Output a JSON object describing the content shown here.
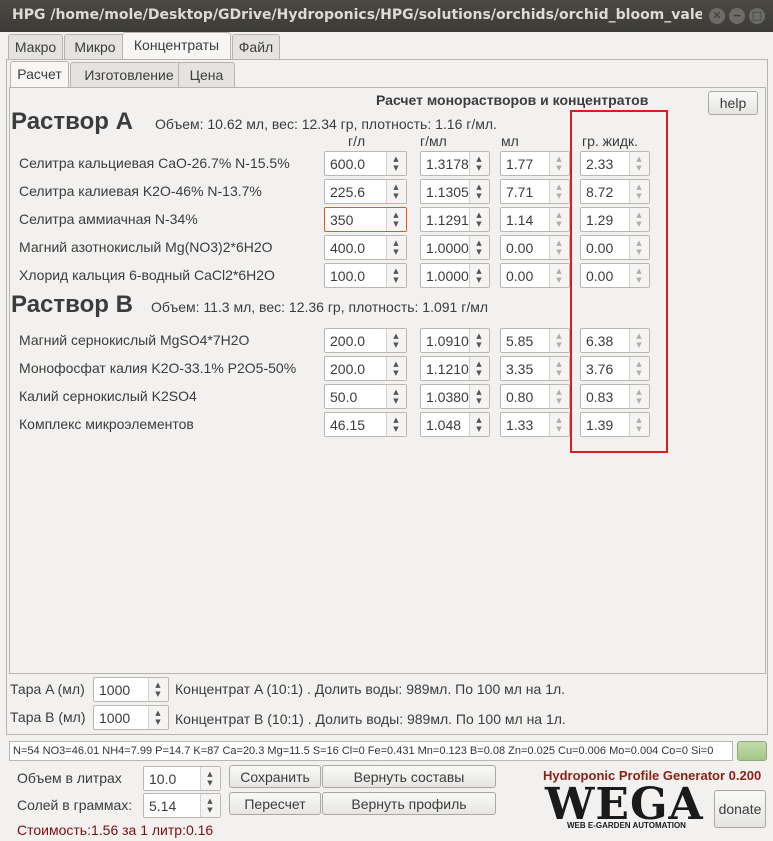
{
  "window": {
    "title": "HPG /home/mole/Desktop/GDrive/Hydroponics/HPG/solutions/orchids/orchid_bloom_valery.hp..."
  },
  "top_tabs": [
    "Макро",
    "Микро",
    "Концентраты",
    "Файл"
  ],
  "sub_tabs": [
    "Расчет",
    "Изготовление",
    "Цена"
  ],
  "main": {
    "section_title": "Расчет монорастворов и концентратов",
    "help_label": "help",
    "col_headers": [
      "г/л",
      "г/мл",
      "мл",
      "гр. жидк."
    ],
    "solution_a": {
      "title": "Раствор A",
      "info": "Объем: 10.62 мл, вес: 12.34 гр, плотность: 1.16 г/мл.",
      "rows": [
        {
          "name": "Селитра кальциевая CaO-26.7% N-15.5%",
          "gl": "600.0",
          "gml": "1.3178",
          "ml": "1.77",
          "gr": "2.33"
        },
        {
          "name": "Селитра калиевая K2O-46% N-13.7%",
          "gl": "225.6",
          "gml": "1.1305",
          "ml": "7.71",
          "gr": "8.72"
        },
        {
          "name": "Селитра аммиачная N-34%",
          "gl": "350",
          "gml": "1.1291",
          "ml": "1.14",
          "gr": "1.29"
        },
        {
          "name": "Магний азотнокислый Mg(NO3)2*6H2O",
          "gl": "400.0",
          "gml": "1.0000",
          "ml": "0.00",
          "gr": "0.00"
        },
        {
          "name": "Хлорид кальция 6-водный CaCl2*6H2O",
          "gl": "100.0",
          "gml": "1.0000",
          "ml": "0.00",
          "gr": "0.00"
        }
      ]
    },
    "solution_b": {
      "title": "Раствор B",
      "info": "Объем: 11.3 мл, вес: 12.36 гр, плотность: 1.091 г/мл",
      "rows": [
        {
          "name": "Магний сернокислый MgSO4*7H2O",
          "gl": "200.0",
          "gml": "1.0910",
          "ml": "5.85",
          "gr": "6.38"
        },
        {
          "name": "Монофосфат калия K2O-33.1% P2O5-50%",
          "gl": "200.0",
          "gml": "1.1210",
          "ml": "3.35",
          "gr": "3.76"
        },
        {
          "name": "Калий сернокислый K2SO4",
          "gl": "50.0",
          "gml": "1.0380",
          "ml": "0.80",
          "gr": "0.83"
        },
        {
          "name": "Комплекс микроэлементов",
          "gl": "46.15",
          "gml": "1.048",
          "ml": "1.33",
          "gr": "1.39"
        }
      ]
    }
  },
  "tara": {
    "a_label": "Тара A (мл)",
    "a_value": "1000",
    "a_info": "Концентрат A (10:1) . Долить воды: 989мл. По 100 мл на 1л.",
    "b_label": "Тара B (мл)",
    "b_value": "1000",
    "b_info": "Концентрат B (10:1) . Долить воды: 989мл. По 100 мл на 1л."
  },
  "status_text": "N=54 NO3=46.01 NH4=7.99 P=14.7 K=87 Ca=20.3 Mg=11.5 S=16 Cl=0 Fe=0.431 Mn=0.123 B=0.08 Zn=0.025 Cu=0.006 Mo=0.004 Co=0 Si=0",
  "bottom": {
    "volume_label": "Объем в литрах",
    "volume_value": "10.0",
    "salts_label": "Солей в граммах:",
    "salts_value": "5.14",
    "save_label": "Сохранить",
    "restore_compositions_label": "Вернуть составы",
    "recalc_label": "Пересчет",
    "restore_profile_label": "Вернуть профиль",
    "cost_text": "Стоимость:1.56 за 1 литр:0.16",
    "brand_text": "Hydroponic Profile Generator 0.200",
    "logo_big": "WEGA",
    "logo_small": "WEB E-GARDEN AUTOMATION",
    "donate_label": "donate"
  },
  "colors": {
    "highlight_box": "#e01b1b",
    "focused_field": "#e2581d",
    "cost_text": "#7a0f0f",
    "brand_text": "#8b2214"
  }
}
